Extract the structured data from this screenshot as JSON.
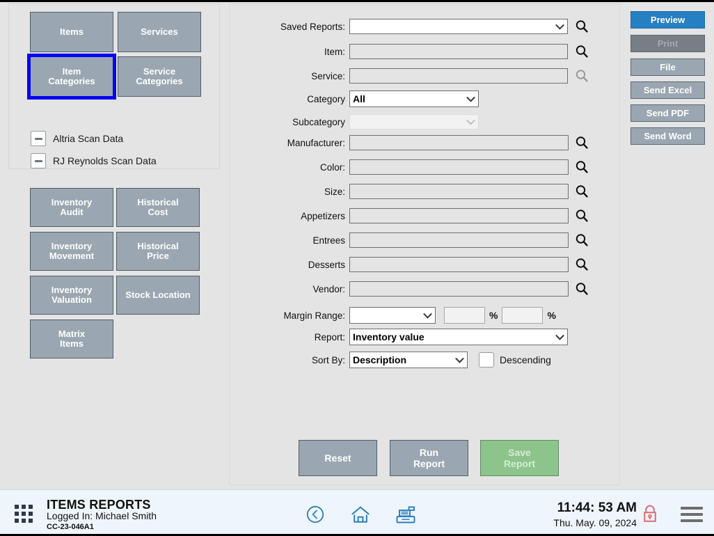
{
  "left": {
    "category_buttons": [
      {
        "label": "Items",
        "name": "items"
      },
      {
        "label": "Services",
        "name": "services"
      },
      {
        "label": "Item\nCategories",
        "name": "item-categories",
        "selected": true
      },
      {
        "label": "Service\nCategories",
        "name": "service-categories"
      }
    ],
    "scan_data": [
      {
        "label": "Altria Scan Data",
        "icon": "minus-icon"
      },
      {
        "label": "RJ Reynolds Scan Data",
        "icon": "minus-icon"
      }
    ],
    "report_buttons": [
      {
        "label": "Inventory\nAudit",
        "name": "inventory-audit"
      },
      {
        "label": "Historical\nCost",
        "name": "historical-cost"
      },
      {
        "label": "Inventory\nMovement",
        "name": "inventory-movement"
      },
      {
        "label": "Historical\nPrice",
        "name": "historical-price"
      },
      {
        "label": "Inventory\nValuation",
        "name": "inventory-valuation"
      },
      {
        "label": "Stock Location",
        "name": "stock-location"
      },
      {
        "label": "Matrix\nItems",
        "name": "matrix-items"
      }
    ]
  },
  "form": {
    "saved_reports": {
      "label": "Saved Reports:",
      "value": "",
      "type": "combo",
      "search_icon": "search-icon"
    },
    "item": {
      "label": "Item:",
      "value": "",
      "type": "text",
      "search_icon": "search-icon"
    },
    "service": {
      "label": "Service:",
      "value": "",
      "type": "text",
      "search_icon": "search-icon",
      "disabled": true
    },
    "category": {
      "label": "Category",
      "value": "All",
      "type": "combo"
    },
    "subcategory": {
      "label": "Subcategory",
      "value": "",
      "type": "combo",
      "disabled": true
    },
    "manufacturer": {
      "label": "Manufacturer:",
      "value": "",
      "type": "text",
      "search_icon": "search-icon"
    },
    "color": {
      "label": "Color:",
      "value": "",
      "type": "text",
      "search_icon": "search-icon"
    },
    "size": {
      "label": "Size:",
      "value": "",
      "type": "text",
      "search_icon": "search-icon"
    },
    "appetizers": {
      "label": "Appetizers",
      "value": "",
      "type": "text",
      "search_icon": "search-icon"
    },
    "entrees": {
      "label": "Entrees",
      "value": "",
      "type": "text",
      "search_icon": "search-icon"
    },
    "desserts": {
      "label": "Desserts",
      "value": "",
      "type": "text",
      "search_icon": "search-icon"
    },
    "vendor": {
      "label": "Vendor:",
      "value": "",
      "type": "text",
      "search_icon": "search-icon"
    },
    "margin_range": {
      "label": "Margin Range:",
      "op_value": "",
      "from_value": "",
      "to_value": "",
      "unit1": "%",
      "unit2": "%"
    },
    "report": {
      "label": "Report:",
      "value": "Inventory value",
      "type": "combo"
    },
    "sort_by": {
      "label": "Sort By:",
      "value": "Description",
      "type": "combo"
    },
    "descending": {
      "label": "Descending",
      "checked": false
    }
  },
  "actions": {
    "reset": "Reset",
    "run_report": "Run\nReport",
    "save_report": "Save\nReport"
  },
  "output_buttons": [
    {
      "label": "Preview",
      "name": "preview",
      "accent": "#2580c3"
    },
    {
      "label": "Print",
      "name": "print",
      "disabled": true
    },
    {
      "label": "File",
      "name": "file"
    },
    {
      "label": "Send Excel",
      "name": "send-excel"
    },
    {
      "label": "Send PDF",
      "name": "send-pdf"
    },
    {
      "label": "Send Word",
      "name": "send-word"
    }
  ],
  "statusbar": {
    "apps_icon": "apps-grid-icon",
    "title": "ITEMS REPORTS",
    "user": "Logged In:  Michael Smith",
    "code": "CC-23-046A1",
    "icons": [
      "back-circle-icon",
      "home-icon",
      "cash-register-icon",
      "lock-icon",
      "hamburger-menu-icon"
    ],
    "time": "11:44: 53 AM",
    "date": "Thu. May. 09, 2024"
  },
  "colors": {
    "accent_blue": "#2580c3",
    "slab_gray": "#9aa7b2",
    "save_green": "#8cc48c",
    "selection_outline": "#0505f0",
    "statusbar_bg": "#eff5fd",
    "icon_blue": "#2b7fb8",
    "lock_red": "#e06a72"
  }
}
